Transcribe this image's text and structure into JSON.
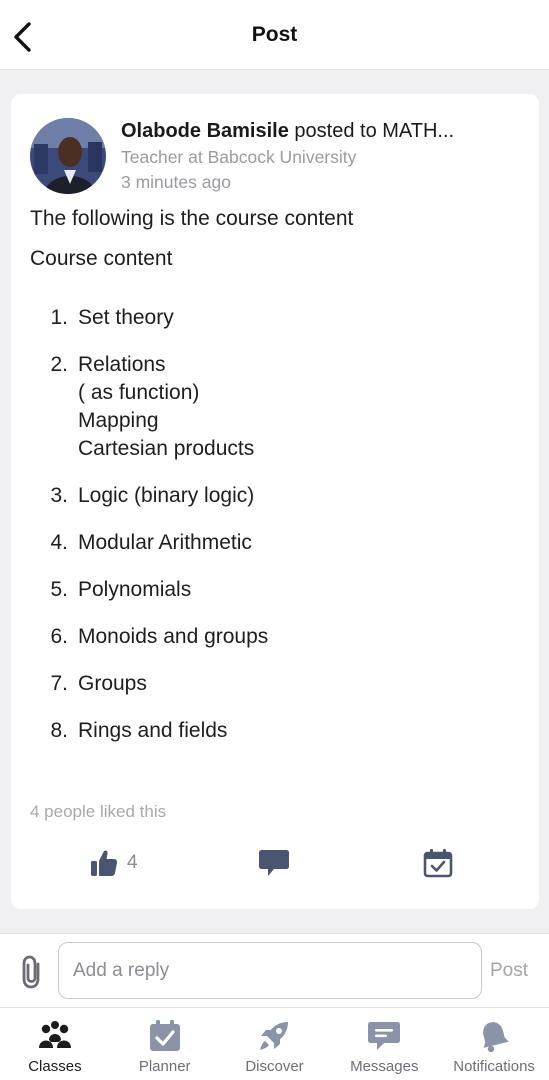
{
  "header": {
    "title": "Post"
  },
  "post": {
    "author": "Olabode Bamisile",
    "posted_to": " posted to MATH...",
    "subtitle": "Teacher at Babcock University",
    "timestamp": "3 minutes ago",
    "intro": "The following is the course content",
    "content_heading": "Course content",
    "items": [
      {
        "num": "1.",
        "text": "Set theory"
      },
      {
        "num": "2.",
        "text": "Relations\n( as function)\nMapping\nCartesian products"
      },
      {
        "num": "3.",
        "text": "Logic (binary logic)"
      },
      {
        "num": "4.",
        "text": "Modular Arithmetic"
      },
      {
        "num": "5.",
        "text": "Polynomials"
      },
      {
        "num": "6.",
        "text": "Monoids and groups"
      },
      {
        "num": "7.",
        "text": "Groups"
      },
      {
        "num": "8.",
        "text": "Rings and fields"
      }
    ],
    "likes_text": "4 people liked this",
    "like_count": "4"
  },
  "reply": {
    "placeholder": "Add a reply",
    "post_label": "Post"
  },
  "tabs": [
    {
      "label": "Classes",
      "icon": "classes-icon",
      "active": true
    },
    {
      "label": "Planner",
      "icon": "planner-icon",
      "active": false
    },
    {
      "label": "Discover",
      "icon": "rocket-icon",
      "active": false
    },
    {
      "label": "Messages",
      "icon": "chat-bubble-icon",
      "active": false
    },
    {
      "label": "Notifications",
      "icon": "bell-icon",
      "active": false
    }
  ],
  "colors": {
    "icon": "#4a5670",
    "active_icon": "#1c1c1e",
    "muted": "#9a9aa3"
  }
}
